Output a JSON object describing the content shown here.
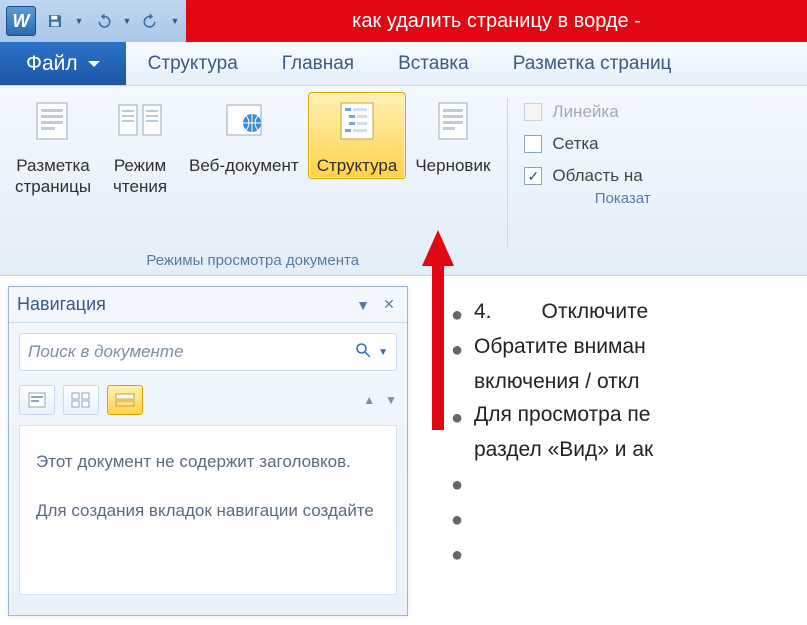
{
  "titlebar": {
    "title": "как удалить страницу в ворде -"
  },
  "tabs": {
    "file": "Файл",
    "items": [
      "Структура",
      "Главная",
      "Вставка",
      "Разметка страниц"
    ]
  },
  "ribbon": {
    "views": [
      {
        "label": "Разметка\nстраницы"
      },
      {
        "label": "Режим\nчтения"
      },
      {
        "label": "Веб-документ"
      },
      {
        "label": "Структура",
        "active": true
      },
      {
        "label": "Черновик"
      }
    ],
    "views_group_label": "Режимы просмотра документа",
    "show": {
      "ruler": "Линейка",
      "gridlines": "Сетка",
      "navpane": "Область на",
      "group_label": "Показат"
    }
  },
  "navpane": {
    "title": "Навигация",
    "search_placeholder": "Поиск в документе",
    "body_p1": "Этот документ не содержит заголовков.",
    "body_p2": "Для создания вкладок навигации создайте"
  },
  "document": {
    "rows": [
      {
        "bullet": true,
        "num": "4.",
        "text": "Отключите"
      },
      {
        "bullet": true,
        "text": "Обратите вниман"
      },
      {
        "bullet": false,
        "text": "включения / откл"
      },
      {
        "bullet": true,
        "text": "Для просмотра пе"
      },
      {
        "bullet": false,
        "text": "раздел «Вид» и ак"
      },
      {
        "bullet": true,
        "text": ""
      },
      {
        "bullet": true,
        "text": ""
      },
      {
        "bullet": true,
        "text": ""
      }
    ]
  }
}
